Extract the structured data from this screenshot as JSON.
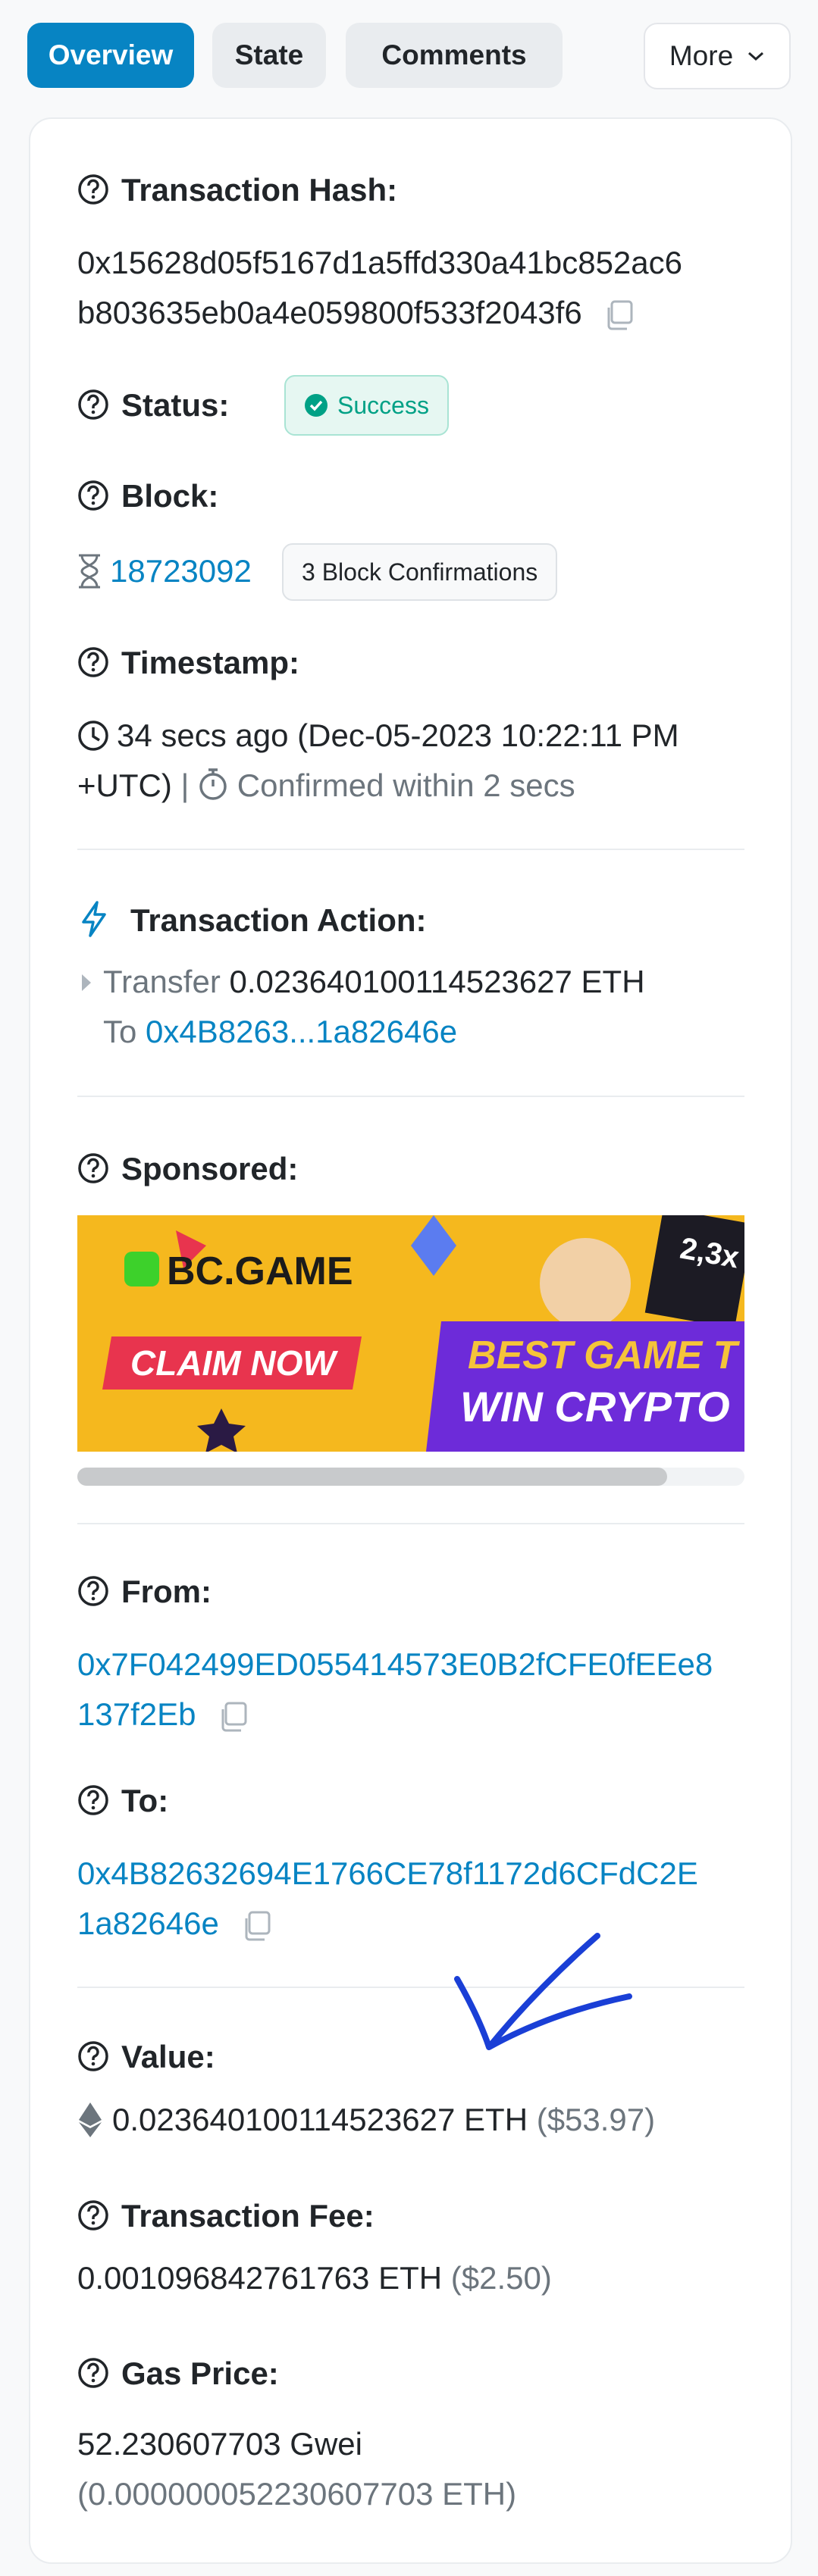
{
  "tabs": {
    "overview": "Overview",
    "state": "State",
    "comments": "Comments",
    "more": "More"
  },
  "tx_hash": {
    "label": "Transaction Hash:",
    "line1": "0x15628d05f5167d1a5ffd330a41bc852ac6",
    "line2": "b803635eb0a4e059800f533f2043f6"
  },
  "status": {
    "label": "Status:",
    "value": "Success"
  },
  "block": {
    "label": "Block:",
    "number": "18723092",
    "confirmations": "3 Block Confirmations"
  },
  "timestamp": {
    "label": "Timestamp:",
    "line1": "34 secs ago (Dec-05-2023 10:22:11 PM",
    "line2_prefix": "+UTC)",
    "separator": "|",
    "confirmed": "Confirmed within 2 secs"
  },
  "action": {
    "label": "Transaction Action:",
    "transfer_word": "Transfer",
    "amount": "0.023640100114523627 ETH",
    "to_word": "To",
    "to_address": "0x4B8263...1a82646e"
  },
  "sponsored": {
    "label": "Sponsored:",
    "ad_logo": "BC.GAME",
    "ad_cta": "CLAIM NOW",
    "ad_line1": "BEST GAME T",
    "ad_line2": "WIN CRYPTO",
    "ad_multiplier": "2,3x"
  },
  "from": {
    "label": "From:",
    "line1": "0x7F042499ED055414573E0B2fCFE0fEEe8",
    "line2": "137f2Eb"
  },
  "to": {
    "label": "To:",
    "line1": "0x4B82632694E1766CE78f1172d6CFdC2E",
    "line2": "1a82646e"
  },
  "value": {
    "label": "Value:",
    "amount": "0.023640100114523627 ETH",
    "usd": "($53.97)"
  },
  "fee": {
    "label": "Transaction Fee:",
    "amount": "0.001096842761763 ETH",
    "usd": "($2.50)"
  },
  "gas": {
    "label": "Gas Price:",
    "line1": "52.230607703 Gwei",
    "line2": "(0.000000052230607703 ETH)"
  },
  "colors": {
    "accent": "#0784c3",
    "success": "#00a186",
    "annotation_arrow": "#1a3fd6"
  }
}
